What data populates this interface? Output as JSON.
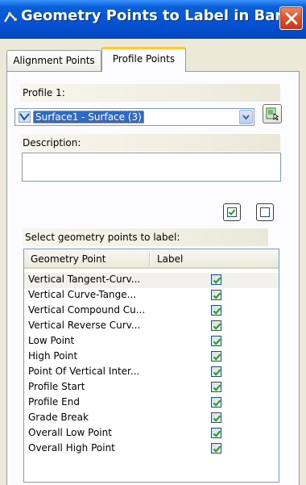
{
  "window": {
    "title": "Geometry Points to Label in Band",
    "close_icon": "close-icon",
    "app_icon": "dialog-app-icon"
  },
  "tabs": [
    {
      "label": "Alignment Points",
      "active": false
    },
    {
      "label": "Profile Points",
      "active": true
    }
  ],
  "profile": {
    "label": "Profile 1:",
    "selected": "Surface1 - Surface (3)",
    "icon": "surface-profile-icon",
    "pick_button_icon": "pick-from-drawing-icon"
  },
  "description": {
    "label": "Description:",
    "value": ""
  },
  "bulk": {
    "check_all_icon": "check-all-icon",
    "uncheck_all_icon": "uncheck-all-icon"
  },
  "grid": {
    "caption": "Select geometry points to label:",
    "headers": {
      "name": "Geometry Point",
      "label": "Label"
    },
    "rows": [
      {
        "name": "Vertical Tangent-Curv...",
        "checked": true
      },
      {
        "name": "Vertical Curve-Tange...",
        "checked": true
      },
      {
        "name": "Vertical Compound Cu...",
        "checked": true
      },
      {
        "name": "Vertical Reverse Curv...",
        "checked": true
      },
      {
        "name": "Low Point",
        "checked": true
      },
      {
        "name": "High Point",
        "checked": true
      },
      {
        "name": "Point Of Vertical Inter...",
        "checked": true
      },
      {
        "name": "Profile Start",
        "checked": true
      },
      {
        "name": "Profile End",
        "checked": true
      },
      {
        "name": "Grade Break",
        "checked": true
      },
      {
        "name": "Overall Low Point",
        "checked": true
      },
      {
        "name": "Overall High Point",
        "checked": true
      }
    ]
  },
  "colors": {
    "titlebar": "#0554d6",
    "check": "#21a121",
    "selection": "#316ac5"
  }
}
